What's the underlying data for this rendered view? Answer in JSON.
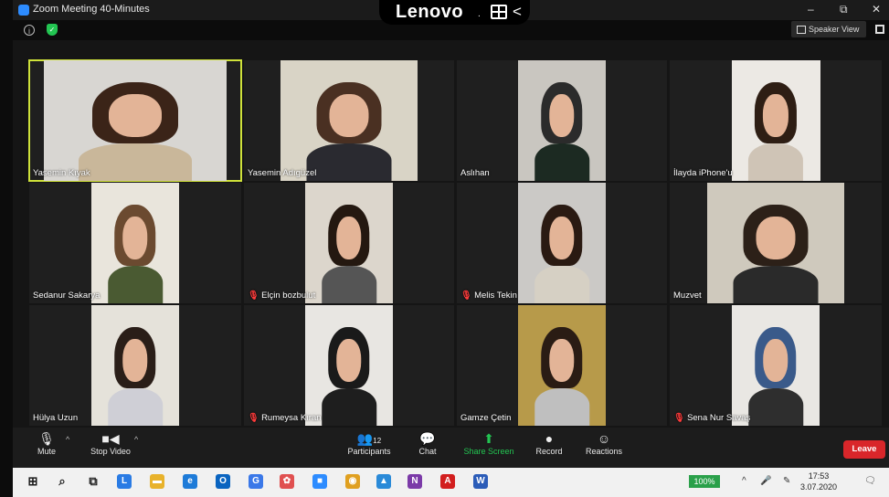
{
  "window": {
    "title": "Zoom Meeting 40-Minutes",
    "minimize": "‒",
    "restore": "⧉",
    "close": "✕"
  },
  "laptop": {
    "brand": "Lenovo",
    "dot": ".",
    "back_glyph": "<"
  },
  "topbar": {
    "info_glyph": "i",
    "shield_glyph": "✓",
    "speaker_view_label": "Speaker View"
  },
  "participants": [
    {
      "name": "Yasemin Kıyak",
      "muted": false,
      "active": true,
      "bg": "#d8d6d2",
      "hair": "#3b2418",
      "shirt": "#c9b79a"
    },
    {
      "name": "Yasemin Adıgüzel",
      "muted": false,
      "active": false,
      "bg": "#d9d4c6",
      "hair": "#4a3022",
      "shirt": "#2a2a30"
    },
    {
      "name": "Aslıhan",
      "muted": false,
      "active": false,
      "bg": "#c9c6c0",
      "hair": "#2b2b2b",
      "shirt": "#1c2a22"
    },
    {
      "name": "İlayda iPhone'u",
      "muted": false,
      "active": false,
      "bg": "#ece9e4",
      "hair": "#2e1e14",
      "shirt": "#cfc4b6"
    },
    {
      "name": "Sedanur Sakarya",
      "muted": false,
      "active": false,
      "bg": "#e9e5dc",
      "hair": "#6b4a30",
      "shirt": "#4a5a32"
    },
    {
      "name": "Elçin bozbulut",
      "muted": true,
      "active": false,
      "bg": "#dcd6cc",
      "hair": "#241810",
      "shirt": "#555"
    },
    {
      "name": "Melis Tekin",
      "muted": true,
      "active": false,
      "bg": "#cbc9c6",
      "hair": "#2a1a12",
      "shirt": "#d6d0c4"
    },
    {
      "name": "Muzvet",
      "muted": false,
      "active": false,
      "bg": "#cfc9bd",
      "hair": "#2c2018",
      "shirt": "#2a2a2a"
    },
    {
      "name": "Hülya Uzun",
      "muted": false,
      "active": false,
      "bg": "#e5e2da",
      "hair": "#2a1e18",
      "shirt": "#cfcfd6"
    },
    {
      "name": "Rumeysa Kıran",
      "muted": true,
      "active": false,
      "bg": "#e8e6e2",
      "hair": "#1a1a1a",
      "shirt": "#1e1e1e"
    },
    {
      "name": "Gamze Çetin",
      "muted": false,
      "active": false,
      "bg": "#b79a4a",
      "hair": "#2a1c14",
      "shirt": "#bfbfbf"
    },
    {
      "name": "Sena Nur Savaş",
      "muted": true,
      "active": false,
      "bg": "#e9e7e3",
      "hair": "#3a5a8a",
      "shirt": "#2e2e2e"
    }
  ],
  "controls": {
    "mute": {
      "label": "Mute",
      "glyph": "🎙"
    },
    "stop_video": {
      "label": "Stop Video",
      "glyph": "■◀"
    },
    "caret": "^",
    "participants": {
      "label": "Participants",
      "glyph": "👥",
      "count": "12"
    },
    "chat": {
      "label": "Chat",
      "glyph": "💬"
    },
    "share_screen": {
      "label": "Share Screen",
      "glyph": "⬆"
    },
    "record": {
      "label": "Record",
      "glyph": "●"
    },
    "reactions": {
      "label": "Reactions",
      "glyph": "☺"
    },
    "leave": {
      "label": "Leave"
    }
  },
  "taskbar": {
    "battery": "100%",
    "time": "17:53",
    "date": "3.07.2020",
    "icons": [
      {
        "name": "windows-start-icon",
        "glyph": "⊞",
        "color": "#1a1a1a"
      },
      {
        "name": "search-icon",
        "glyph": "⌕",
        "color": "#1a1a1a"
      },
      {
        "name": "task-view-icon",
        "glyph": "⧉",
        "color": "#1a1a1a"
      },
      {
        "name": "app-l-icon",
        "glyph": "L",
        "color": "#2a7be4"
      },
      {
        "name": "file-explorer-icon",
        "glyph": "▬",
        "color": "#e8b22b"
      },
      {
        "name": "edge-icon",
        "glyph": "e",
        "color": "#1e7bd8"
      },
      {
        "name": "outlook-icon",
        "glyph": "O",
        "color": "#0a64c0"
      },
      {
        "name": "google-icon",
        "glyph": "G",
        "color": "#3a78e8"
      },
      {
        "name": "app-red-icon",
        "glyph": "✿",
        "color": "#e05050"
      },
      {
        "name": "zoom-icon",
        "glyph": "■",
        "color": "#2d8cff"
      },
      {
        "name": "chrome-icon",
        "glyph": "◉",
        "color": "#e0a020"
      },
      {
        "name": "app-blue-icon",
        "glyph": "▲",
        "color": "#2a8ad8"
      },
      {
        "name": "onenote-icon",
        "glyph": "N",
        "color": "#7b3aa8"
      },
      {
        "name": "acrobat-icon",
        "glyph": "A",
        "color": "#d21e1e"
      },
      {
        "name": "word-icon",
        "glyph": "W",
        "color": "#2b5cb8"
      }
    ],
    "tray": {
      "chevron": "^",
      "mic": "🎤",
      "pen": "✎",
      "notif": "🗨"
    }
  }
}
